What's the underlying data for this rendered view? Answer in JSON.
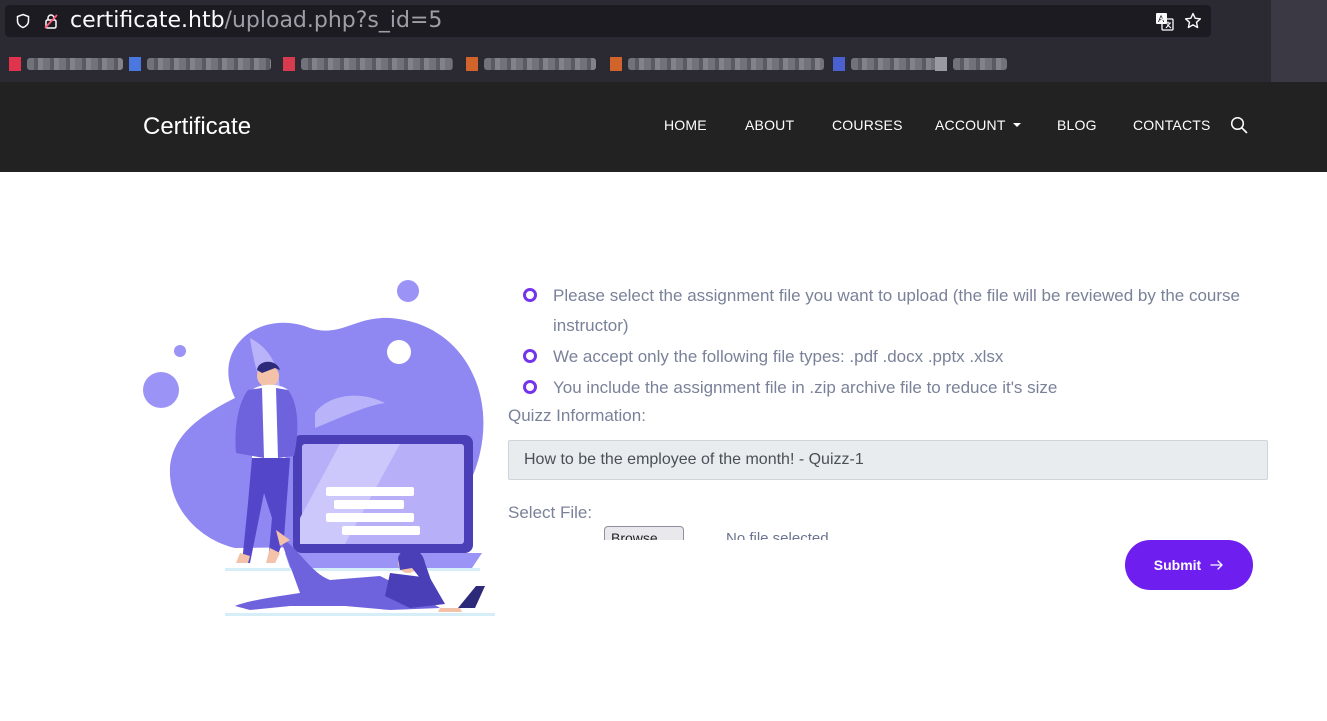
{
  "browser": {
    "url_host": "certificate.htb",
    "url_path": "/upload.php?s_id=5"
  },
  "navbar": {
    "brand": "Certificate",
    "items": [
      {
        "label": "HOME"
      },
      {
        "label": "ABOUT"
      },
      {
        "label": "COURSES"
      },
      {
        "label": "ACCOUNT"
      },
      {
        "label": "BLOG"
      },
      {
        "label": "CONTACTS"
      }
    ]
  },
  "instructions": [
    "Please select the assignment file you want to upload (the file will be reviewed by the course instructor)",
    "We accept only the following file types: .pdf .docx .pptx .xlsx",
    "You include the assignment file in .zip archive file to reduce it's size"
  ],
  "form": {
    "quiz_label": "Quizz Information:",
    "quiz_value": "How to be the employee of the month! - Quizz-1",
    "file_label": "Select File:",
    "browse_label": "Browse...",
    "no_file_text": "No file selected.",
    "submit_label": "Submit"
  },
  "colors": {
    "accent": "#6f1ef0",
    "navbar_bg": "#222222",
    "illustration": "#9b93f5"
  }
}
